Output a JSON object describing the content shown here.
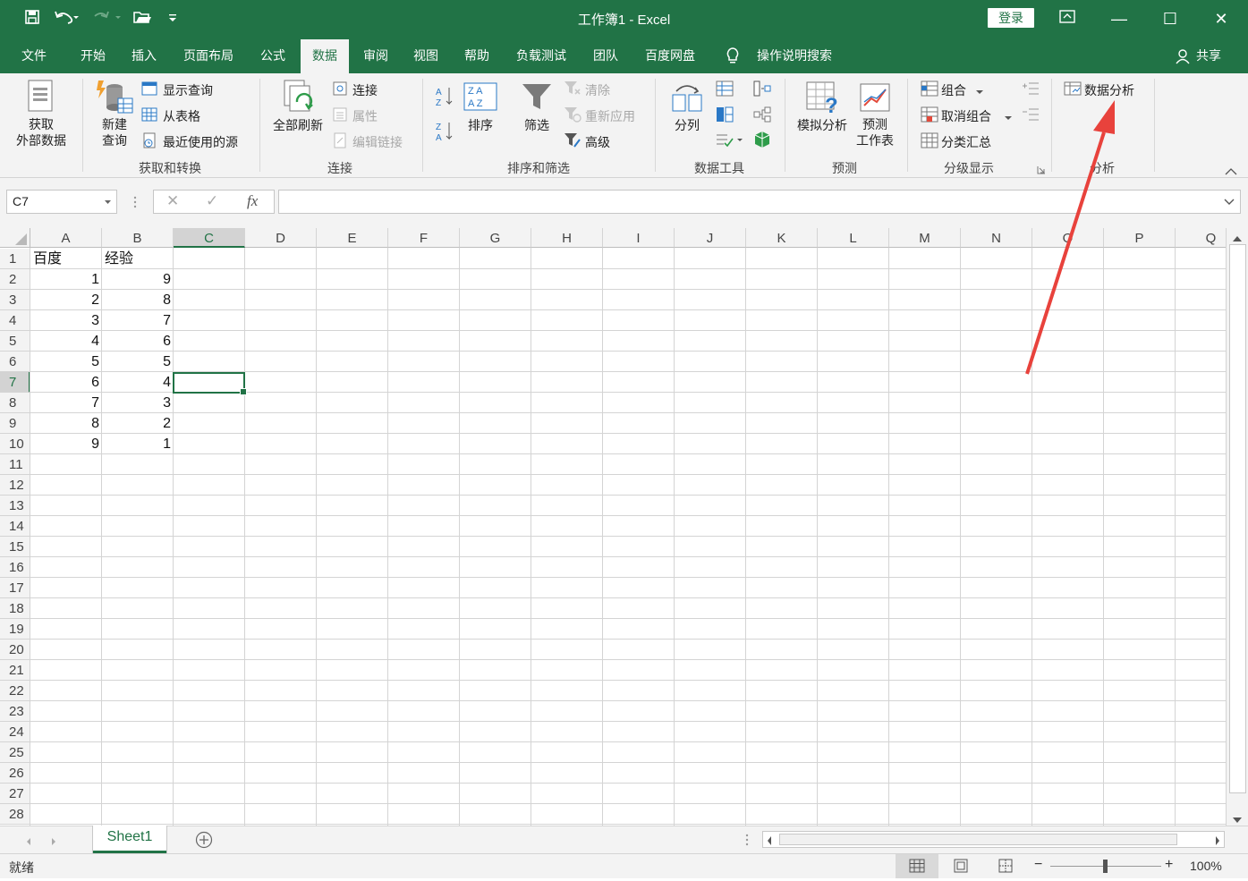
{
  "window": {
    "title": "工作簿1  -  Excel",
    "login_label": "登录",
    "minimize_glyph": "—",
    "maximize_glyph": "☐",
    "close_glyph": "✕"
  },
  "tabs": [
    {
      "label": "文件"
    },
    {
      "label": "开始"
    },
    {
      "label": "插入"
    },
    {
      "label": "页面布局"
    },
    {
      "label": "公式"
    },
    {
      "label": "数据"
    },
    {
      "label": "审阅"
    },
    {
      "label": "视图"
    },
    {
      "label": "帮助"
    },
    {
      "label": "负载测试"
    },
    {
      "label": "团队"
    },
    {
      "label": "百度网盘"
    }
  ],
  "tell_me": "操作说明搜索",
  "share_label": "共享",
  "ribbon": {
    "get_transform": {
      "label": "获取和转换",
      "get_external_1": "获取",
      "get_external_2": "外部数据",
      "new_query_1": "新建",
      "new_query_2": "查询",
      "show_query": "显示查询",
      "from_table": "从表格",
      "recent_sources": "最近使用的源"
    },
    "connections": {
      "label": "连接",
      "refresh_all": "全部刷新",
      "connections": "连接",
      "properties": "属性",
      "edit_links": "编辑链接"
    },
    "sort_filter": {
      "label": "排序和筛选",
      "sort": "排序",
      "filter": "筛选",
      "clear": "清除",
      "reapply": "重新应用",
      "advanced": "高级"
    },
    "data_tools": {
      "label": "数据工具",
      "text_to_columns": "分列"
    },
    "forecast": {
      "label": "预测",
      "what_if": "模拟分析",
      "forecast_sheet_1": "预测",
      "forecast_sheet_2": "工作表"
    },
    "outline": {
      "label": "分级显示",
      "group": "组合",
      "ungroup": "取消组合",
      "subtotal": "分类汇总"
    },
    "analysis": {
      "label": "分析",
      "data_analysis": "数据分析"
    }
  },
  "formula_bar": {
    "name_box": "C7",
    "fx": "fx",
    "cancel": "✕",
    "enter": "✓",
    "content": ""
  },
  "columns": [
    "A",
    "B",
    "C",
    "D",
    "E",
    "F",
    "G",
    "H",
    "I",
    "J",
    "K",
    "L",
    "M",
    "N",
    "O",
    "P",
    "Q"
  ],
  "rows": [
    "1",
    "2",
    "3",
    "4",
    "5",
    "6",
    "7",
    "8",
    "9",
    "10",
    "11",
    "12",
    "13",
    "14",
    "15",
    "16",
    "17",
    "18",
    "19",
    "20",
    "21",
    "22",
    "23",
    "24",
    "25",
    "26",
    "27",
    "28"
  ],
  "cells": {
    "A": [
      "百度",
      "1",
      "2",
      "3",
      "4",
      "5",
      "6",
      "7",
      "8",
      "9"
    ],
    "B": [
      "经验",
      "9",
      "8",
      "7",
      "6",
      "5",
      "4",
      "3",
      "2",
      "1"
    ]
  },
  "selected_cell": {
    "col": "C",
    "row": "7"
  },
  "sheets": [
    {
      "name": "Sheet1"
    }
  ],
  "status": {
    "ready": "就绪",
    "zoom": "100%",
    "zoom_minus": "−",
    "zoom_plus": "+"
  },
  "colors": {
    "excel_green": "#217346",
    "annotation_arrow": "#e8423c"
  }
}
